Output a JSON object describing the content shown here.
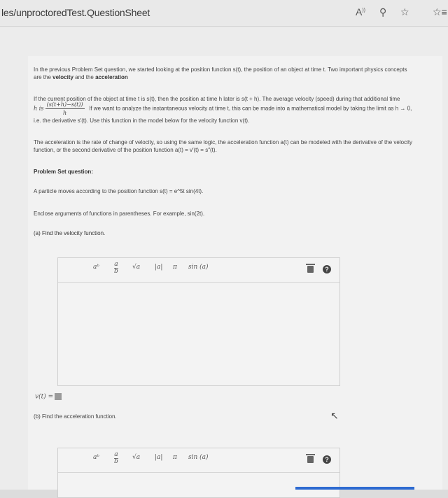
{
  "browser": {
    "url_text": "les/unproctoredTest.QuestionSheet",
    "icons": [
      "read-aloud-icon",
      "search-icon",
      "favorite-icon",
      "favorites-bar-icon"
    ]
  },
  "intro": {
    "line1": "In the previous Problem Set question, we started looking at the position function s(t), the position of an object at time t. Two important physics concepts",
    "line2_prefix": "are the ",
    "velocity": "velocity",
    "and": " and the ",
    "acceleration": "acceleration"
  },
  "para2": {
    "line1": "If the current position of the object at time t is s(t), then the position at time h later is s(t + h). The average velocity (speed) during that additional time",
    "h_is": "h is",
    "frac_num": "(s(t+h)−s(t))",
    "frac_den": "h",
    "line2_rest": "If we want to analyze the instantaneous velocity at time t, this can be made into a mathematical model by taking the limit as h → 0,",
    "line3": "i.e. the derivative s′(t). Use this function in the model below for the velocity function v(t)."
  },
  "para3": {
    "line1": "The acceleration is the rate of change of velocity, so using the same logic, the acceleration function a(t) can be modeled with the derivative of the velocity",
    "line2": "function, or the second derivative of the position function a(t) = v′(t) = s″(t)."
  },
  "problem_heading": "Problem Set question:",
  "problem_text": "A particle moves according to the position function s(t) = e^5t sin(4t).",
  "instructions": "Enclose arguments of functions in parentheses. For example, sin(2t).",
  "part_a": {
    "label": "(a) Find the velocity function.",
    "answer_label": "v(t) ="
  },
  "part_b": {
    "label": "(b) Find the acceleration function."
  },
  "toolbar": {
    "power": "aᵇ",
    "fraction_num": "a",
    "fraction_den": "b",
    "sqrt": "√a",
    "abs": "|a|",
    "pi": "π",
    "sin": "sin (a)",
    "help": "?"
  }
}
